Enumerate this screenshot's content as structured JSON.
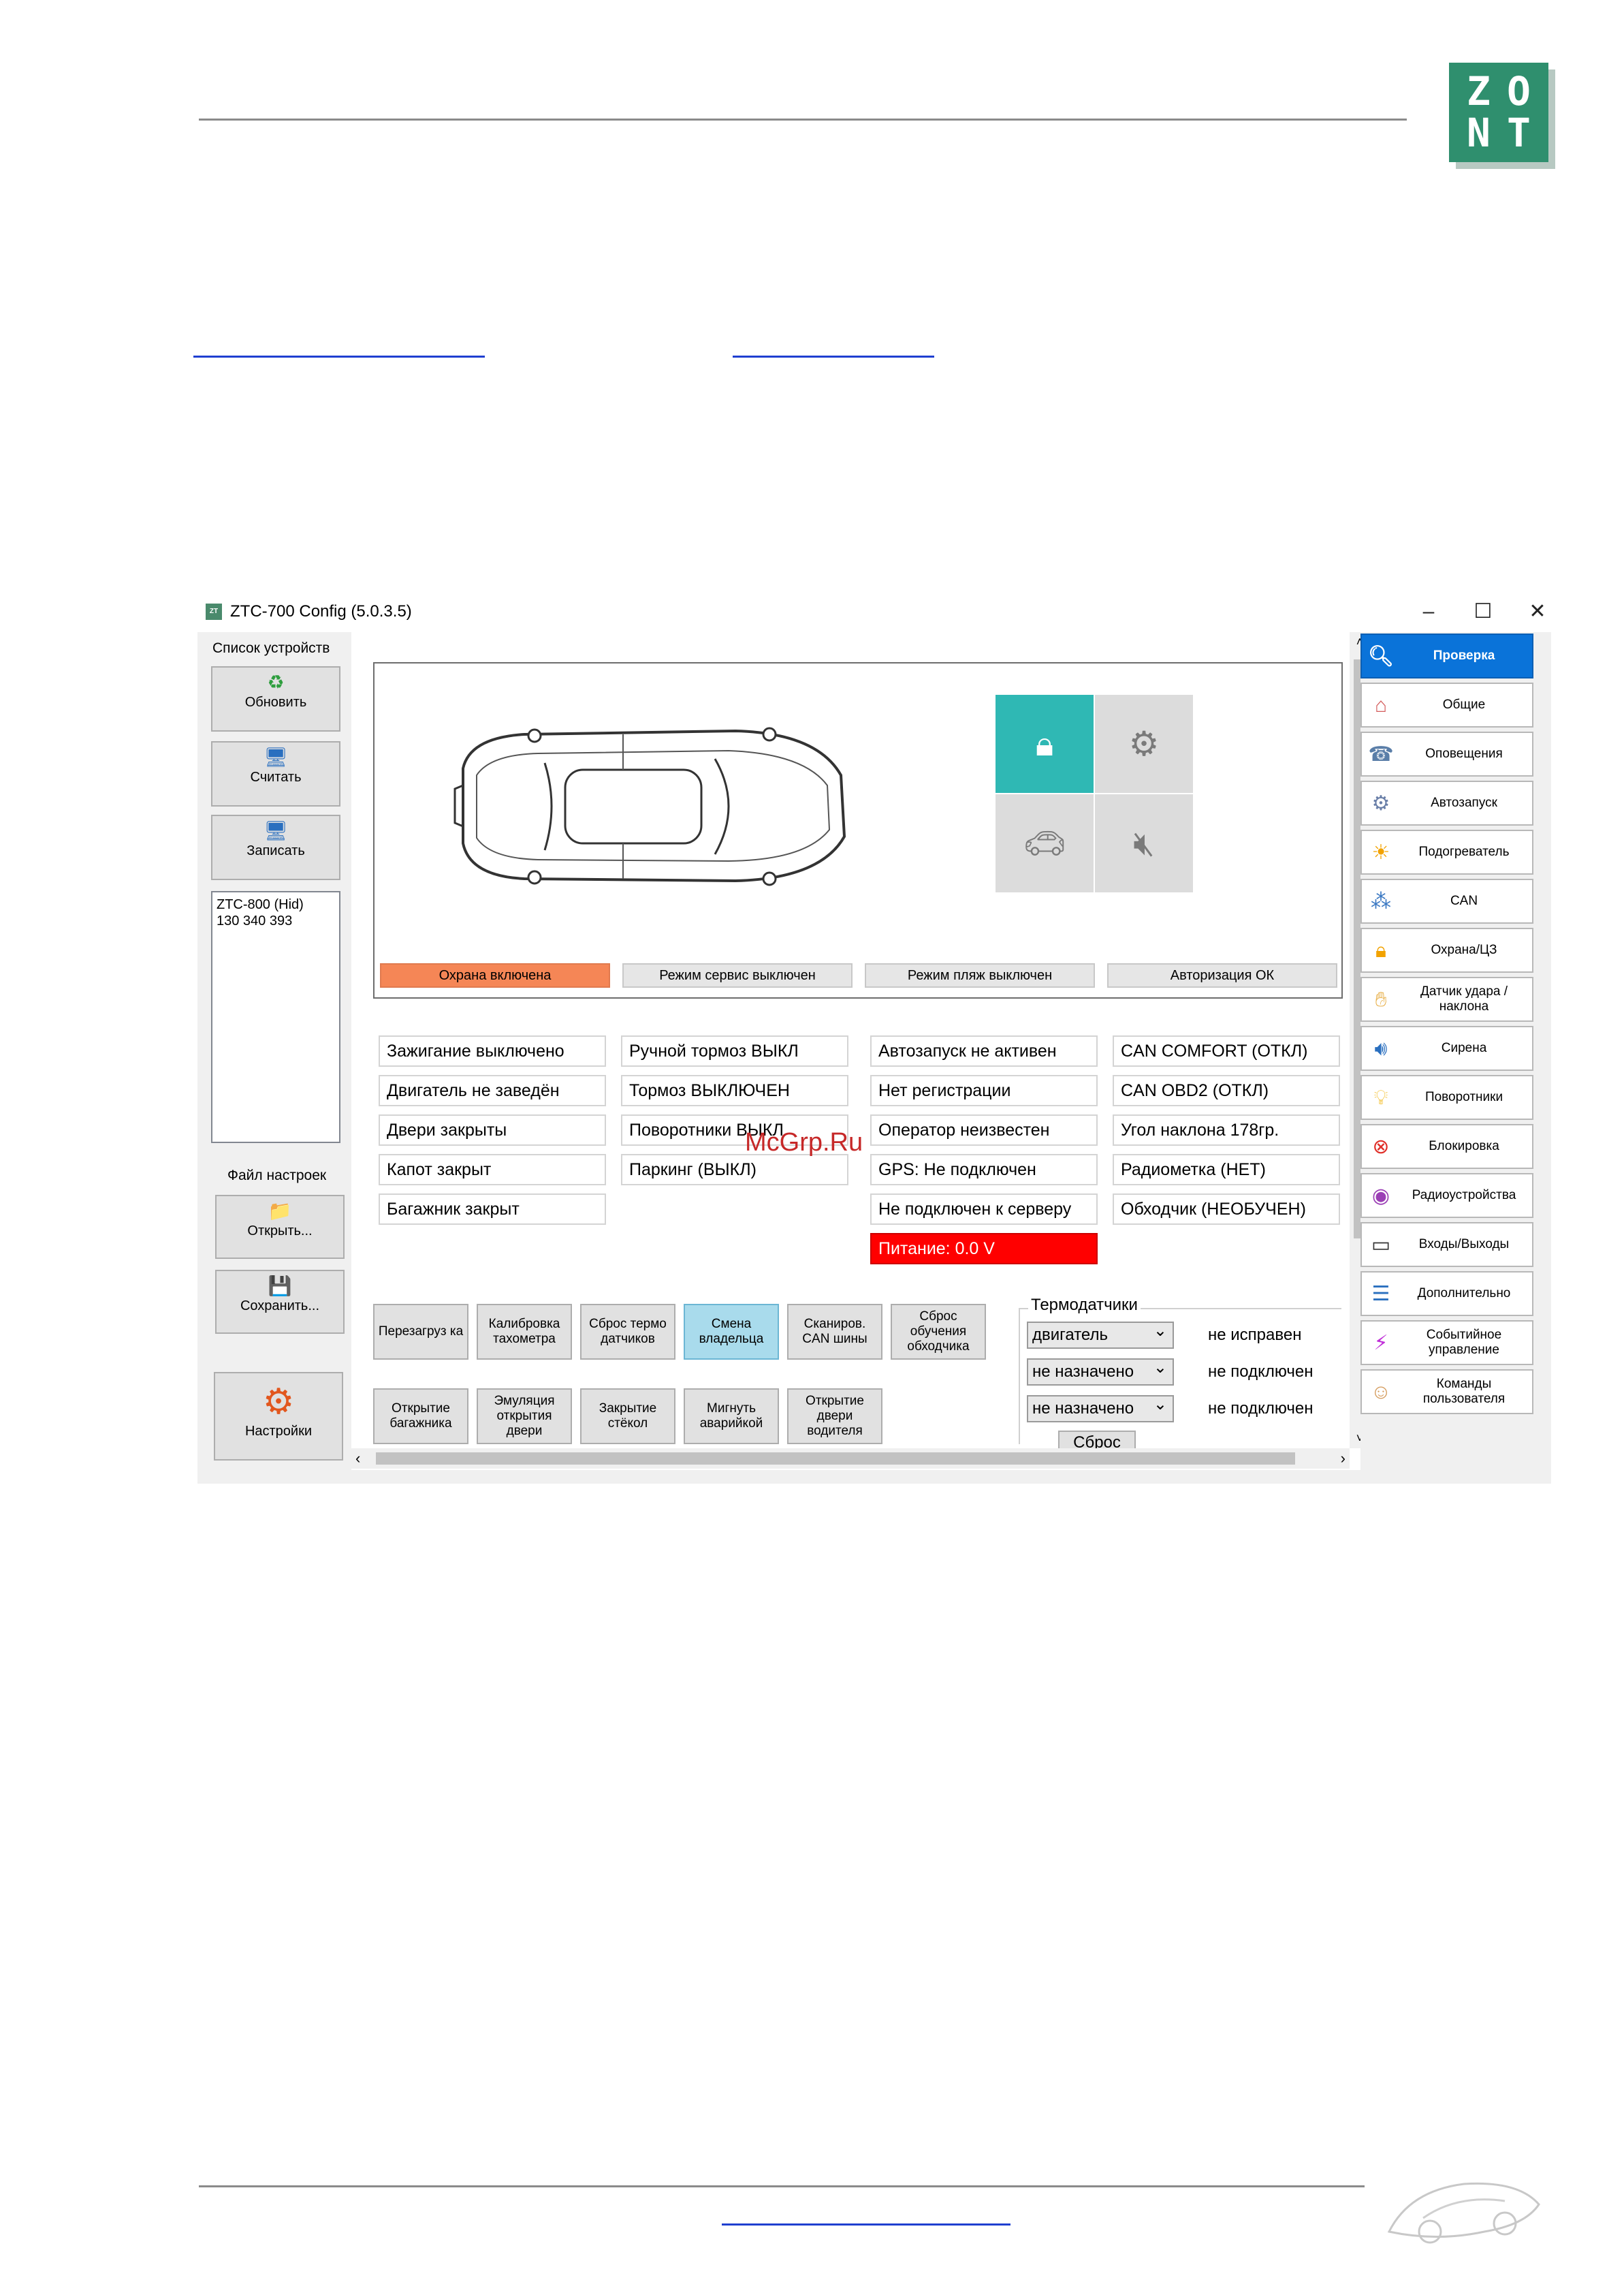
{
  "logo": {
    "letters": [
      "Z",
      "O",
      "N",
      "T"
    ],
    "color": "#2f8f6e"
  },
  "window": {
    "title": "ZTC-700 Config  (5.0.3.5)"
  },
  "left_panel": {
    "devices_title": "Список устройств",
    "refresh": "Обновить",
    "read": "Считать",
    "write": "Записать",
    "device_lines": [
      "ZTC-800  (Hid)",
      "130 340 393"
    ],
    "file_title": "Файл настроек",
    "open": "Открыть...",
    "save": "Сохранить...",
    "settings": "Настройки"
  },
  "car_panel": {
    "modes": [
      "Охрана включена",
      "Режим сервис выключен",
      "Режим пляж выключен",
      "Авторизация ОК"
    ],
    "tiles": [
      "lock-icon",
      "engine-icon",
      "car-alarm-icon",
      "mute-icon"
    ]
  },
  "status": {
    "col1": [
      "Зажигание выключено",
      "Двигатель не заведён",
      "Двери закрыты",
      "Капот закрыт",
      "Багажник закрыт"
    ],
    "col2": [
      "Ручной тормоз ВЫКЛ",
      "Тормоз ВЫКЛЮЧЕН",
      "Поворотники ВЫКЛ",
      "Паркинг (ВЫКЛ)"
    ],
    "col3": [
      "Автозапуск не активен",
      "Нет регистрации",
      "Оператор неизвестен",
      "GPS: Не подключен",
      "Не подключен к серверу"
    ],
    "col4": [
      "CAN COMFORT (ОТКЛ)",
      "CAN OBD2 (ОТКЛ)",
      "Угол наклона 178гр.",
      "Радиометка (НЕТ)",
      "Обходчик (НЕОБУЧЕН)"
    ],
    "power": "Питание: 0.0 V"
  },
  "watermark": "McGrp.Ru",
  "actions": {
    "row1": [
      "Перезагруз ка",
      "Калибровка тахометра",
      "Сброс термо датчиков",
      "Смена владельца",
      "Сканиров. CAN шины",
      "Сброс обучения обходчика"
    ],
    "row2": [
      "Открытие багажника",
      "Эмуляция открытия двери",
      "Закрытие стёкол",
      "Мигнуть аварийкой",
      "Открытие двери водителя"
    ]
  },
  "thermo": {
    "title": "Термодатчики",
    "rows": [
      {
        "select": "двигатель",
        "state": "не исправен"
      },
      {
        "select": "не назначено",
        "state": "не подключен"
      },
      {
        "select": "не назначено",
        "state": "не подключен"
      }
    ],
    "reset": "Сброс"
  },
  "nav": [
    "Проверка",
    "Общие",
    "Оповещения",
    "Автозапуск",
    "Подогреватель",
    "CAN",
    "Охрана/ЦЗ",
    "Датчик удара / наклона",
    "Сирена",
    "Поворотники",
    "Блокировка",
    "Радиоустройства",
    "Входы/Выходы",
    "Дополнительно",
    "Событийное управление",
    "Команды пользователя"
  ]
}
